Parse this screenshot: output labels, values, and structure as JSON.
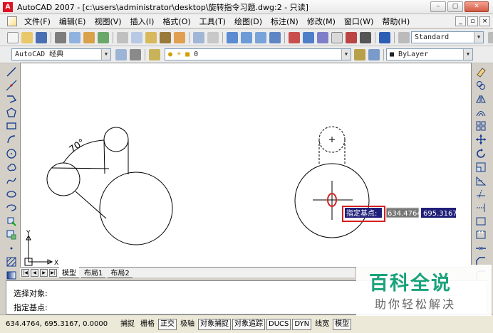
{
  "window": {
    "title": "AutoCAD 2007 - [c:\\users\\administrator\\desktop\\旋转指令习题.dwg:2 - 只读]",
    "app_icon": "autocad-logo-icon",
    "min_label": "–",
    "max_label": "▢",
    "close_label": "✕"
  },
  "menubar": {
    "items": [
      "文件(F)",
      "编辑(E)",
      "视图(V)",
      "插入(I)",
      "格式(O)",
      "工具(T)",
      "绘图(D)",
      "标注(N)",
      "修改(M)",
      "窗口(W)",
      "帮助(H)"
    ],
    "mdi_buttons": [
      "_",
      "▫",
      "×"
    ]
  },
  "toolbar1": {
    "text_style_value": "Standard"
  },
  "toolbar2": {
    "workspace_value": "AutoCAD 经典",
    "layer_value": "0",
    "color_value": "ByLayer"
  },
  "drawing": {
    "dimension_text": "70°",
    "ucs_x": "X",
    "ucs_y": "Y",
    "tooltip_label": "指定基点:",
    "input_x": "634.4764",
    "input_y": "695.3167",
    "highlight_color": "#d42020",
    "tooltip_bg": "#1f1f7a"
  },
  "layout_tabs": {
    "nav": [
      "|◀",
      "◀",
      "▶",
      "▶|"
    ],
    "tabs": [
      "模型",
      "布局1",
      "布局2"
    ],
    "active": "模型"
  },
  "command": {
    "line1": "选择对象:",
    "line2": "指定基点:"
  },
  "statusbar": {
    "coords": "634.4764,  695.3167,  0.0000",
    "buttons": [
      {
        "label": "捕捉",
        "on": false
      },
      {
        "label": "栅格",
        "on": false
      },
      {
        "label": "正交",
        "on": true
      },
      {
        "label": "极轴",
        "on": false
      },
      {
        "label": "对象捕捉",
        "on": true
      },
      {
        "label": "对象追踪",
        "on": true
      },
      {
        "label": "DUCS",
        "on": true
      },
      {
        "label": "DYN",
        "on": true
      },
      {
        "label": "线宽",
        "on": false
      },
      {
        "label": "模型",
        "on": true
      }
    ]
  },
  "watermark": {
    "title": "百科全说",
    "subtitle": "助你轻松解决"
  }
}
